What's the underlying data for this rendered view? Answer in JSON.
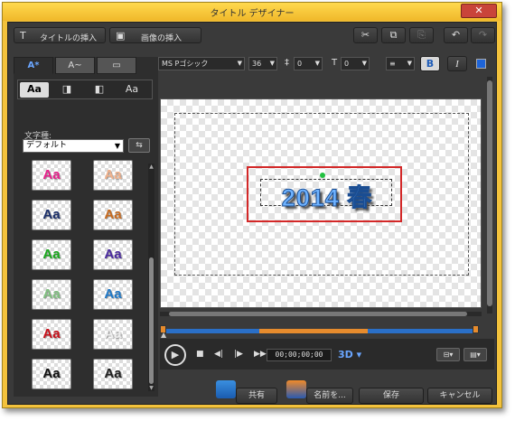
{
  "window": {
    "title": "タイトル デザイナー",
    "close_glyph": "✕"
  },
  "toolbar": {
    "insert_title_label": "タイトルの挿入",
    "insert_image_label": "画像の挿入",
    "cut_icon": "✂",
    "copy_icon": "⧉",
    "paste_icon": "📋",
    "undo_icon": "↶",
    "redo_icon": "↷"
  },
  "left_panel": {
    "tabs": [
      "A*",
      "A~",
      "▭"
    ],
    "styles": [
      "Aa",
      "◨",
      "◧",
      "Aa"
    ],
    "font_label": "文字種:",
    "font_value": "デフォルト",
    "presets": [
      {
        "text": "Aa",
        "color": "#e8208c"
      },
      {
        "text": "Aa",
        "color": "#f0b08a"
      },
      {
        "text": "Aa",
        "color": "#1b2f6a"
      },
      {
        "text": "Aa",
        "color": "#c86a1e"
      },
      {
        "text": "Aa",
        "color": "#19a81c"
      },
      {
        "text": "Aa",
        "color": "#4a2aa0"
      },
      {
        "text": "Aa",
        "color": "#7fbf7f"
      },
      {
        "text": "Aa",
        "color": "#1e78c8"
      },
      {
        "text": "Aa",
        "color": "#c8101a"
      },
      {
        "text": "Aa",
        "color": "#eeeeee"
      },
      {
        "text": "Aa",
        "color": "#111111"
      },
      {
        "text": "Aa",
        "color": "#222222"
      }
    ]
  },
  "format_bar": {
    "font_family": "MS Pゴシック",
    "font_size": "36",
    "line_spacing": "0",
    "char_spacing": "0",
    "bold": "B",
    "italic": "I"
  },
  "preview": {
    "title_text": "2014 春"
  },
  "transport": {
    "timecode": "00;00;00;00",
    "three_d": "3D"
  },
  "footer": {
    "share_label": "共有",
    "save_as_label": "名前を...",
    "save_label": "保存",
    "cancel_label": "キャンセル"
  },
  "colors": {
    "accent": "#6aa6ff",
    "highlight_box": "#d32828",
    "timeline_blue": "#2a6fc7",
    "timeline_orange": "#e68b2d"
  }
}
